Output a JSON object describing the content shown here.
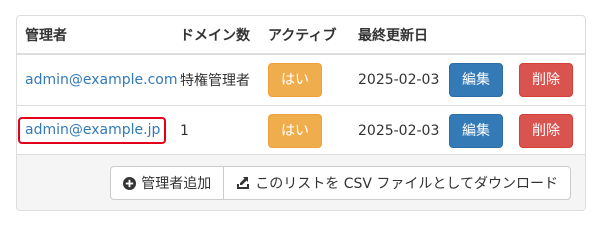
{
  "table": {
    "headers": [
      "管理者",
      "ドメイン数",
      "アクティブ",
      "最終更新日"
    ],
    "rows": [
      {
        "admin": "admin@example.com",
        "domains": "特権管理者",
        "active": "はい",
        "updated": "2025-02-03",
        "edit": "編集",
        "delete": "削除"
      },
      {
        "admin": "admin@example.jp",
        "domains": "1",
        "active": "はい",
        "updated": "2025-02-03",
        "edit": "編集",
        "delete": "削除"
      }
    ]
  },
  "footer": {
    "add_admin": "管理者追加",
    "download_csv": "このリストを CSV ファイルとしてダウンロード",
    "add_icon": "plus-circle-icon",
    "download_icon": "download-icon"
  },
  "colors": {
    "link": "#337ab7",
    "warning": "#f0ad4e",
    "primary": "#337ab7",
    "danger": "#d9534f",
    "highlight": "#e2001a"
  }
}
